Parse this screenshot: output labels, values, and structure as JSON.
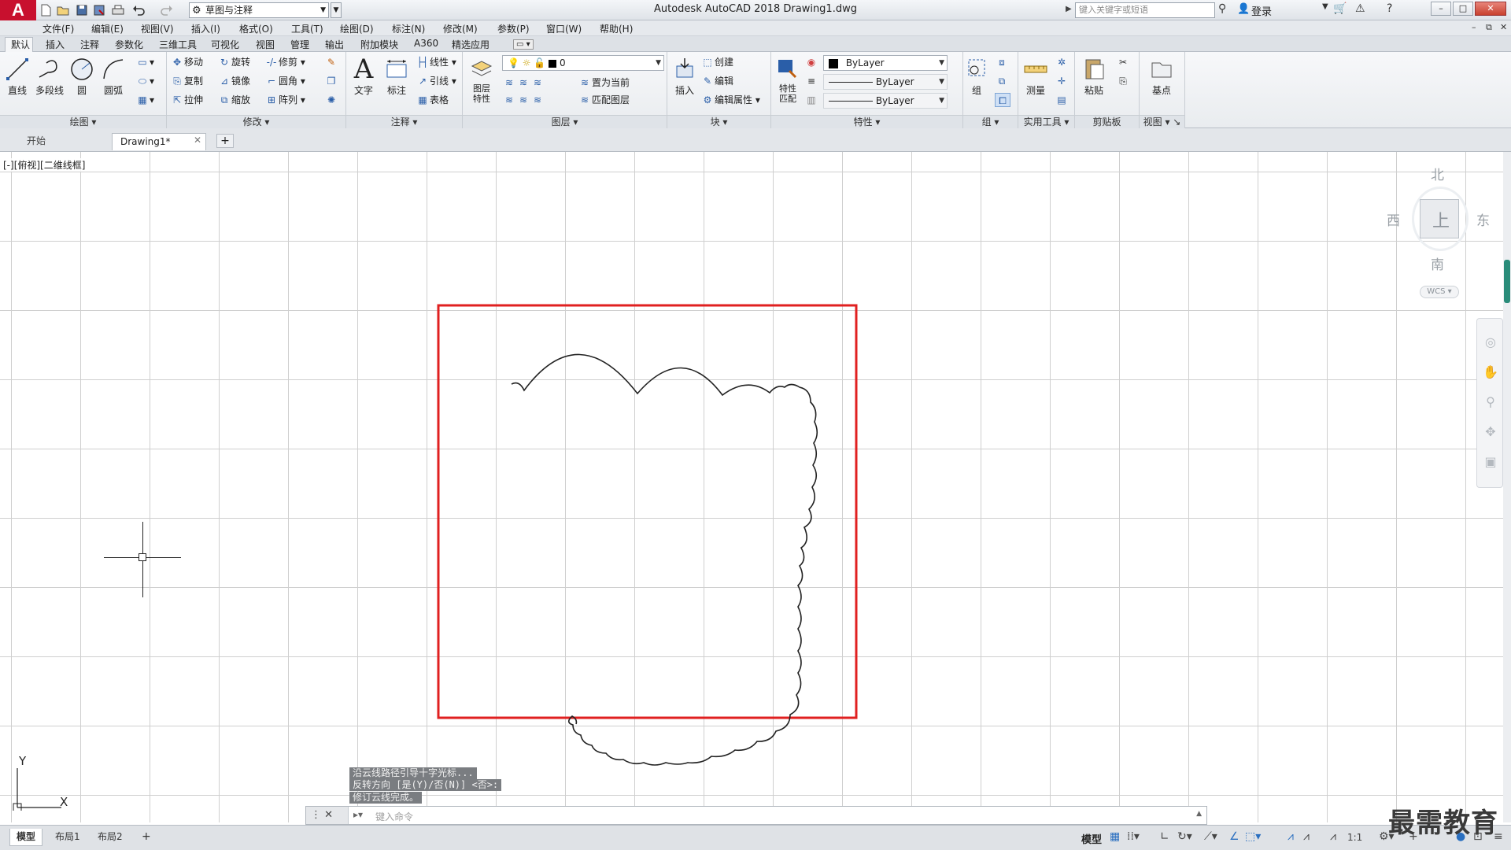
{
  "titlebar": {
    "app_logo": "A",
    "workspace": "草图与注释",
    "title": "Autodesk AutoCAD 2018    Drawing1.dwg",
    "search_placeholder": "键入关键字或短语",
    "login": "登录"
  },
  "menus": [
    "文件(F)",
    "编辑(E)",
    "视图(V)",
    "插入(I)",
    "格式(O)",
    "工具(T)",
    "绘图(D)",
    "标注(N)",
    "修改(M)",
    "参数(P)",
    "窗口(W)",
    "帮助(H)"
  ],
  "ribbon_tabs": [
    "默认",
    "插入",
    "注释",
    "参数化",
    "三维工具",
    "可视化",
    "视图",
    "管理",
    "输出",
    "附加模块",
    "A360",
    "精选应用"
  ],
  "ribbon": {
    "draw": {
      "title": "绘图",
      "line": "直线",
      "polyline": "多段线",
      "circle": "圆",
      "arc": "圆弧"
    },
    "modify": {
      "title": "修改",
      "move": "移动",
      "rotate": "旋转",
      "trim": "修剪",
      "copy": "复制",
      "mirror": "镜像",
      "fillet": "圆角",
      "stretch": "拉伸",
      "scale": "缩放",
      "array": "阵列"
    },
    "annotation": {
      "title": "注释",
      "text": "文字",
      "dimension": "标注",
      "linear": "线性",
      "leader": "引线",
      "table": "表格"
    },
    "layers": {
      "title": "图层",
      "properties": "图层\n特性",
      "current_layer": "0",
      "make_current": "置为当前",
      "match_layer": "匹配图层"
    },
    "block": {
      "title": "块",
      "insert": "插入",
      "create": "创建",
      "edit": "编辑",
      "edit_attr": "编辑属性"
    },
    "properties": {
      "title": "特性",
      "match": "特性\n匹配",
      "color": "ByLayer",
      "linetype": "ByLayer",
      "lineweight": "ByLayer"
    },
    "groups": {
      "title": "组",
      "group": "组"
    },
    "utilities": {
      "title": "实用工具",
      "measure": "测量"
    },
    "clipboard": {
      "title": "剪贴板",
      "paste": "粘贴"
    },
    "view": {
      "title": "视图",
      "base": "基点"
    }
  },
  "file_tabs": {
    "start": "开始",
    "drawing": "Drawing1*"
  },
  "viewport_label": "[-][俯视][二维线框]",
  "viewcube": {
    "north": "北",
    "south": "南",
    "east": "东",
    "west": "西",
    "face": "上",
    "wcs": "WCS"
  },
  "command_history": [
    "沿云线路径引导十字光标...",
    "反转方向 [是(Y)/否(N)] <否>:",
    "修订云线完成。"
  ],
  "command_line": {
    "placeholder": "键入命令"
  },
  "ucs": {
    "x": "X",
    "y": "Y"
  },
  "layout_tabs": [
    "模型",
    "布局1",
    "布局2"
  ],
  "status": {
    "model": "模型",
    "scale": "1:1"
  },
  "watermark": "最需教育",
  "colors": {
    "highlight_box": "#e02020",
    "app_red": "#c8102e"
  }
}
